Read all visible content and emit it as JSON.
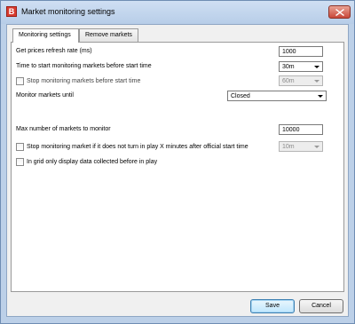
{
  "window": {
    "icon_letter": "B",
    "title": "Market monitoring settings"
  },
  "tabs": [
    {
      "label": "Monitoring settings",
      "active": true
    },
    {
      "label": "Remove markets",
      "active": false
    }
  ],
  "settings": {
    "refresh_rate": {
      "label": "Get prices refresh rate (ms)",
      "value": "1000"
    },
    "start_time": {
      "label": "Time to start monitoring markets before start time",
      "value": "30m"
    },
    "stop_before": {
      "label": "Stop monitoring markets before start time",
      "checked": false,
      "value": "60m"
    },
    "monitor_until": {
      "label": "Monitor markets until",
      "value": "Closed"
    },
    "max_markets": {
      "label": "Max number of markets to monitor",
      "value": "10000"
    },
    "stop_not_inplay": {
      "label": "Stop monitoring market if it does not turn in play X minutes after official start time",
      "checked": false,
      "value": "10m"
    },
    "grid_only": {
      "label": "In grid only display data collected before in play",
      "checked": false
    }
  },
  "buttons": {
    "save": "Save",
    "cancel": "Cancel"
  },
  "colors": {
    "accent": "#d83b2f",
    "frame": "#bcd0e8"
  }
}
